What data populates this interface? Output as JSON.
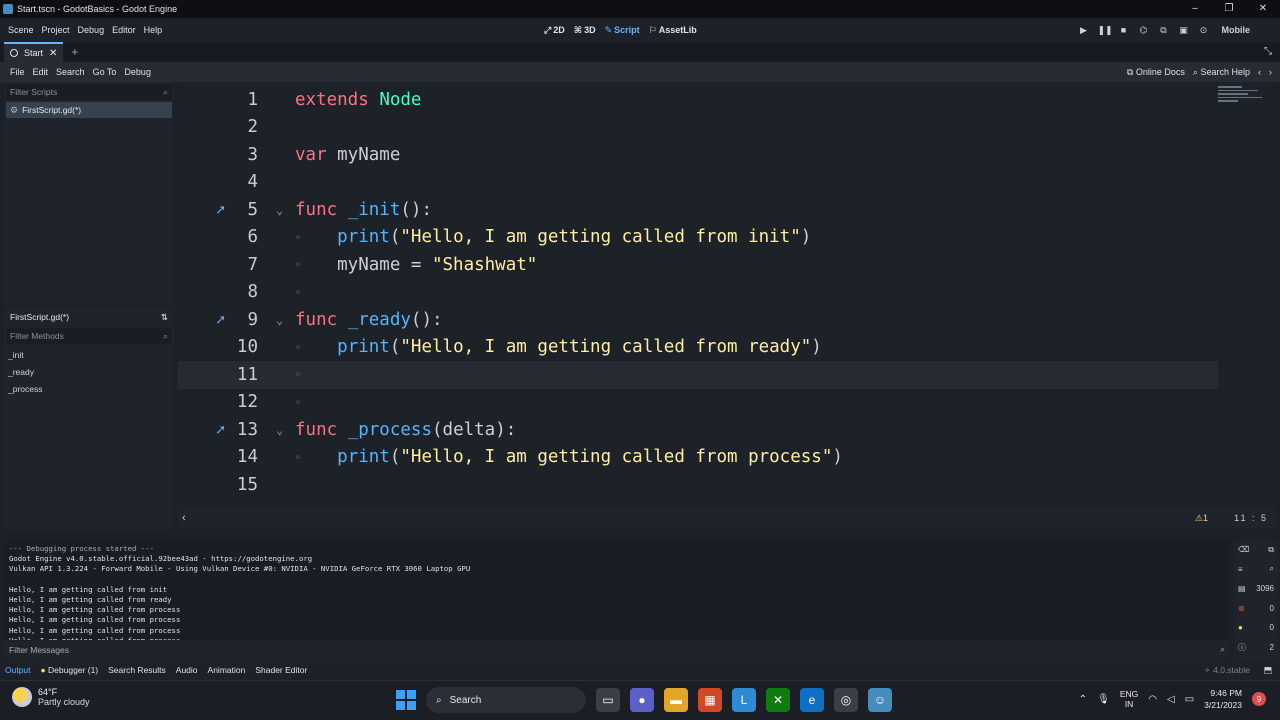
{
  "window": {
    "title": "Start.tscn - GodotBasics - Godot Engine",
    "controls": [
      "–",
      "❐",
      "✕"
    ]
  },
  "main_menu": [
    "Scene",
    "Project",
    "Debug",
    "Editor",
    "Help"
  ],
  "workspaces": [
    {
      "label": "2D",
      "icon": "2d-icon"
    },
    {
      "label": "3D",
      "icon": "3d-icon"
    },
    {
      "label": "Script",
      "icon": "script-icon"
    },
    {
      "label": "AssetLib",
      "icon": "assetlib-icon"
    }
  ],
  "renderer": "Mobile",
  "scene_tab": {
    "label": "Start",
    "add": "+"
  },
  "script_menu": [
    "File",
    "Edit",
    "Search",
    "Go To",
    "Debug"
  ],
  "script_right": {
    "online_docs": "Online Docs",
    "search_help": "Search Help"
  },
  "scripts_panel": {
    "filter_placeholder": "Filter Scripts",
    "items": [
      "FirstScript.gd(*)"
    ]
  },
  "methods_panel": {
    "current_script": "FirstScript.gd(*)",
    "filter_placeholder": "Filter Methods",
    "methods": [
      "_init",
      "_ready",
      "_process"
    ]
  },
  "code_lines": [
    {
      "n": "1",
      "tokens": [
        [
          "kw",
          "extends"
        ],
        [
          "plain",
          " "
        ],
        [
          "cls",
          "Node"
        ]
      ]
    },
    {
      "n": "2",
      "tokens": []
    },
    {
      "n": "3",
      "tokens": [
        [
          "kw",
          "var"
        ],
        [
          "plain",
          " myName"
        ]
      ]
    },
    {
      "n": "4",
      "tokens": []
    },
    {
      "n": "5",
      "icon": true,
      "fold": true,
      "tokens": [
        [
          "kw",
          "func"
        ],
        [
          "plain",
          " "
        ],
        [
          "fn",
          "_init"
        ],
        [
          "plain",
          "():"
        ]
      ]
    },
    {
      "n": "6",
      "dot": true,
      "tokens": [
        [
          "plain",
          "    "
        ],
        [
          "fn",
          "print"
        ],
        [
          "plain",
          "("
        ],
        [
          "str",
          "\"Hello, I am getting called from init\""
        ],
        [
          "plain",
          ")"
        ]
      ]
    },
    {
      "n": "7",
      "dot": true,
      "tokens": [
        [
          "plain",
          "    myName = "
        ],
        [
          "str",
          "\"Shashwat\""
        ]
      ]
    },
    {
      "n": "8",
      "dot": true,
      "tokens": []
    },
    {
      "n": "9",
      "icon": true,
      "fold": true,
      "tokens": [
        [
          "kw",
          "func"
        ],
        [
          "plain",
          " "
        ],
        [
          "fn",
          "_ready"
        ],
        [
          "plain",
          "():"
        ]
      ]
    },
    {
      "n": "10",
      "dot": true,
      "tokens": [
        [
          "plain",
          "    "
        ],
        [
          "fn",
          "print"
        ],
        [
          "plain",
          "("
        ],
        [
          "str",
          "\"Hello, I am getting called from ready\""
        ],
        [
          "plain",
          ")"
        ]
      ]
    },
    {
      "n": "11",
      "dot": true,
      "current": true,
      "tokens": []
    },
    {
      "n": "12",
      "dot": true,
      "tokens": []
    },
    {
      "n": "13",
      "icon": true,
      "fold": true,
      "tokens": [
        [
          "kw",
          "func"
        ],
        [
          "plain",
          " "
        ],
        [
          "fn",
          "_process"
        ],
        [
          "plain",
          "(delta):"
        ]
      ]
    },
    {
      "n": "14",
      "dot": true,
      "tokens": [
        [
          "plain",
          "    "
        ],
        [
          "fn",
          "print"
        ],
        [
          "plain",
          "("
        ],
        [
          "str",
          "\"Hello, I am getting called from process\""
        ],
        [
          "plain",
          ")"
        ]
      ]
    },
    {
      "n": "15",
      "tokens": []
    }
  ],
  "editor_status": {
    "warnings": "⚠1",
    "position": "11 :   5"
  },
  "output_lines": [
    {
      "text": "--- Debugging process started ---",
      "dim": true
    },
    {
      "text": "Godot Engine v4.0.stable.official.92bee43ad - https://godotengine.org"
    },
    {
      "text": "Vulkan API 1.3.224 - Forward Mobile - Using Vulkan Device #0: NVIDIA - NVIDIA GeForce RTX 3060 Laptop GPU"
    },
    {
      "text": ""
    },
    {
      "text": "Hello, I am getting called from init"
    },
    {
      "text": "Hello, I am getting called from ready"
    },
    {
      "text": "Hello, I am getting called from process"
    },
    {
      "text": "Hello, I am getting called from process"
    },
    {
      "text": "Hello, I am getting called from process"
    },
    {
      "text": "Hello, I am getting called from process"
    }
  ],
  "output_counts": {
    "messages": "3096",
    "errors": "0",
    "warnings": "0",
    "info": "2"
  },
  "filter_messages": "Filter Messages",
  "bottom_tabs": [
    "Output",
    "Debugger (1)",
    "Search Results",
    "Audio",
    "Animation",
    "Shader Editor"
  ],
  "version": "4.0.stable",
  "taskbar": {
    "weather_temp": "64°F",
    "weather_desc": "Partly cloudy",
    "search_label": "Search",
    "lang": "ENG",
    "region": "IN",
    "time": "9:46 PM",
    "date": "3/21/2023",
    "notifications": "9"
  }
}
